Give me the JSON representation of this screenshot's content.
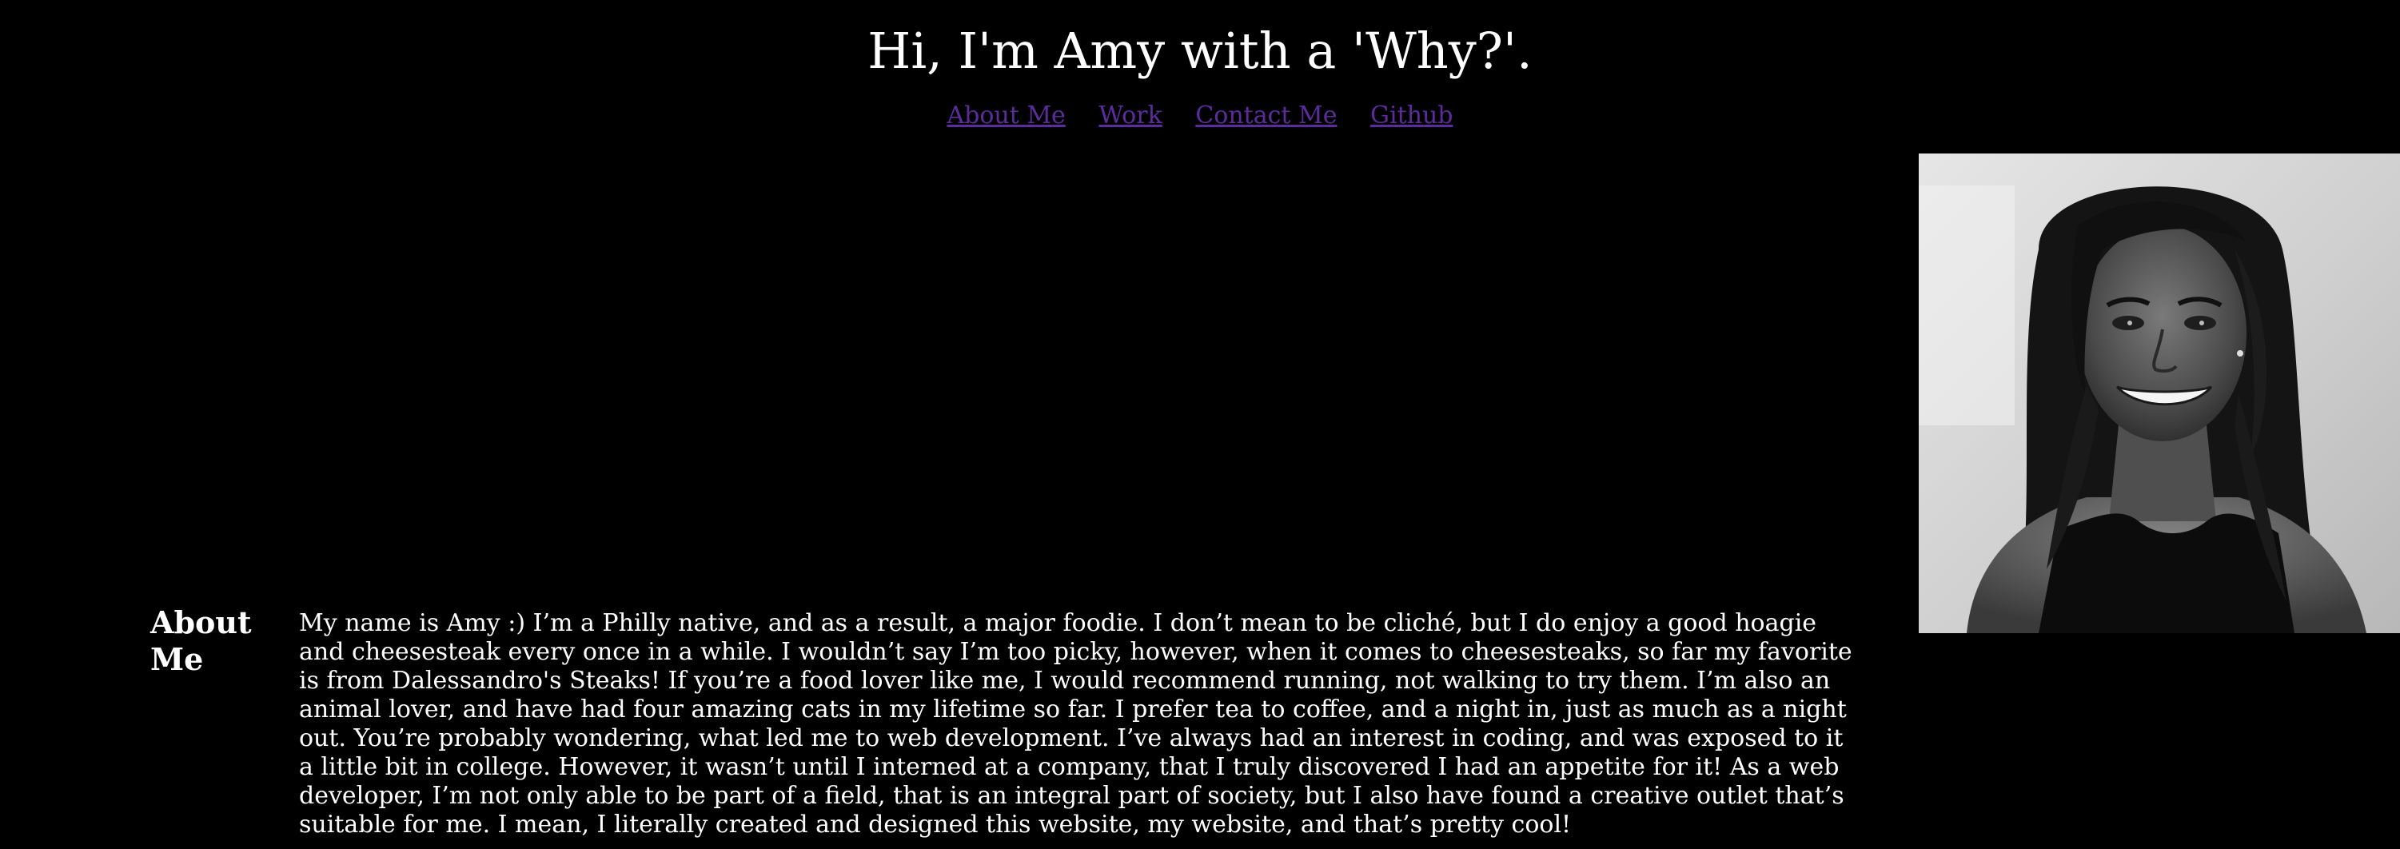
{
  "header": {
    "title": "Hi, I'm Amy with a 'Why?'."
  },
  "nav": {
    "items": [
      {
        "label": "About Me"
      },
      {
        "label": "Work"
      },
      {
        "label": "Contact Me"
      },
      {
        "label": "Github"
      }
    ]
  },
  "about": {
    "heading": "About Me",
    "body": "My name is Amy :) I’m a Philly native, and as a result, a major foodie. I don’t mean to be cliché, but I do enjoy a good hoagie and cheesesteak every once in a while. I wouldn’t say I’m too picky, however, when it comes to cheesesteaks, so far my favorite is from Dalessandro's Steaks! If you’re a food lover like me, I would recommend running, not walking to try them. I’m also an animal lover, and have had four amazing cats in my lifetime so far. I prefer tea to coffee, and a night in, just as much as a night out. You’re probably wondering, what led me to web development. I’ve always had an interest in coding, and was exposed to it a little bit in college. However, it wasn’t until I interned at a company, that I truly discovered I had an appetite for it! As a web developer, I’m not only able to be part of a field, that is an integral part of society, but I also have found a creative outlet that’s suitable for me. I mean, I literally created and designed this website, my website, and that’s pretty cool!"
  },
  "colors": {
    "background": "#000000",
    "text": "#ffffff",
    "link": "#5c2c9c"
  }
}
